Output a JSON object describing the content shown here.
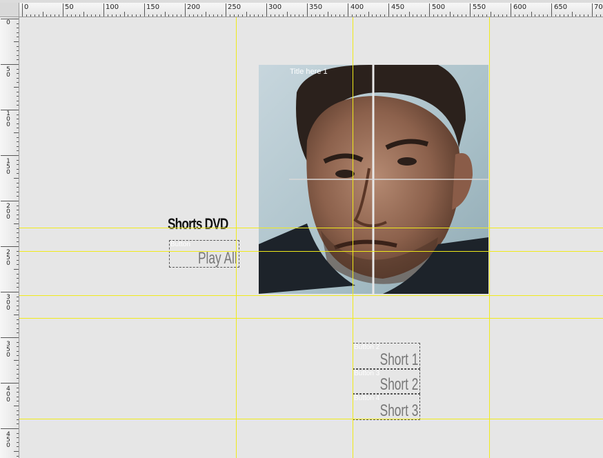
{
  "ruler": {
    "horizontal_labels": [
      "0",
      "50",
      "100",
      "150",
      "200",
      "250",
      "300",
      "350",
      "400",
      "450",
      "500",
      "550",
      "600",
      "650",
      "70"
    ],
    "vertical_labels": [
      "0",
      "50",
      "100",
      "150",
      "200",
      "250",
      "300",
      "350",
      "400",
      "450"
    ]
  },
  "canvas": {
    "photo_caption": "Title here 1",
    "title": "Shorts DVD",
    "buttons": [
      {
        "tag": "Button",
        "label": "Play All"
      },
      {
        "tag": "Button 2",
        "label": "Short 1"
      },
      {
        "tag": "Button 3",
        "label": "Short 2"
      },
      {
        "tag": "Button 4",
        "label": "Short 3"
      }
    ]
  },
  "colors": {
    "guide": "#f0ea1a",
    "canvas_bg": "#e6e6e6",
    "button_text": "#777777"
  }
}
